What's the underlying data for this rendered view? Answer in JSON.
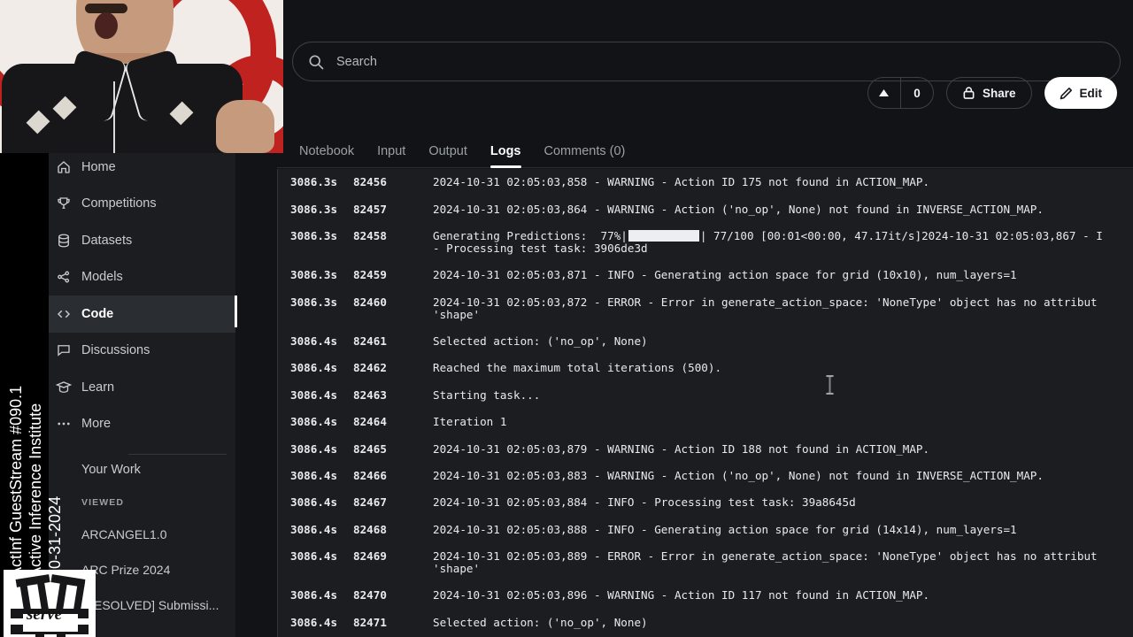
{
  "overlay": {
    "vertical_title_line1": "ActInf GuestStream #090.1",
    "vertical_title_line2": "Active Inference Institute",
    "vertical_title_line3": "10-31-2024",
    "logo_text": "serve"
  },
  "search": {
    "placeholder": "Search",
    "value": "",
    "icon": "search-icon"
  },
  "top_actions": {
    "upvote_icon": "caret-up-icon",
    "vote_count": "0",
    "share_label": "Share",
    "share_icon": "lock-icon",
    "edit_label": "Edit",
    "edit_icon": "pencil-icon"
  },
  "tabs": [
    {
      "label": "Notebook",
      "active": false
    },
    {
      "label": "Input",
      "active": false
    },
    {
      "label": "Output",
      "active": false
    },
    {
      "label": "Logs",
      "active": true
    },
    {
      "label": "Comments (0)",
      "active": false
    }
  ],
  "sidebar": {
    "items": [
      {
        "label": "Home",
        "icon": "home-icon",
        "active": false
      },
      {
        "label": "Competitions",
        "icon": "trophy-icon",
        "active": false
      },
      {
        "label": "Datasets",
        "icon": "datasets-icon",
        "active": false
      },
      {
        "label": "Models",
        "icon": "models-icon",
        "active": false
      },
      {
        "label": "Code",
        "icon": "code-icon",
        "active": true
      },
      {
        "label": "Discussions",
        "icon": "discussions-icon",
        "active": false
      },
      {
        "label": "Learn",
        "icon": "learn-icon",
        "active": false
      },
      {
        "label": "More",
        "icon": "more-icon",
        "active": false
      }
    ],
    "your_work_label": "Your Work",
    "viewed_label": "VIEWED",
    "viewed_items": [
      {
        "label": "ARCANGEL1.0"
      },
      {
        "label": "ARC Prize 2024"
      },
      {
        "label": "[RESOLVED] Submissi..."
      }
    ]
  },
  "logs": {
    "rows": [
      {
        "time": "3086.3s",
        "num": "82456",
        "msg": "2024-10-31 02:05:03,858 - WARNING - Action ID 175 not found in ACTION_MAP."
      },
      {
        "time": "3086.3s",
        "num": "82457",
        "msg": "2024-10-31 02:05:03,864 - WARNING - Action ('no_op', None) not found in INVERSE_ACTION_MAP."
      },
      {
        "time": "3086.3s",
        "num": "82458",
        "msg_pre": "Generating Predictions:  77%|",
        "progress_bar": true,
        "msg_post": "| 77/100 [00:01<00:00, 47.17it/s]2024-10-31 02:05:03,867 - I",
        "msg_cont": "- Processing test task: 3906de3d"
      },
      {
        "time": "3086.3s",
        "num": "82459",
        "msg": "2024-10-31 02:05:03,871 - INFO - Generating action space for grid (10x10), num_layers=1"
      },
      {
        "time": "3086.3s",
        "num": "82460",
        "msg": "2024-10-31 02:05:03,872 - ERROR - Error in generate_action_space: 'NoneType' object has no attribut",
        "msg_cont": "'shape'"
      },
      {
        "time": "3086.4s",
        "num": "82461",
        "msg": "Selected action: ('no_op', None)"
      },
      {
        "time": "3086.4s",
        "num": "82462",
        "msg": "Reached the maximum total iterations (500)."
      },
      {
        "time": "3086.4s",
        "num": "82463",
        "msg": "Starting task..."
      },
      {
        "time": "3086.4s",
        "num": "82464",
        "msg": "Iteration 1"
      },
      {
        "time": "3086.4s",
        "num": "82465",
        "msg": "2024-10-31 02:05:03,879 - WARNING - Action ID 188 not found in ACTION_MAP."
      },
      {
        "time": "3086.4s",
        "num": "82466",
        "msg": "2024-10-31 02:05:03,883 - WARNING - Action ('no_op', None) not found in INVERSE_ACTION_MAP."
      },
      {
        "time": "3086.4s",
        "num": "82467",
        "msg": "2024-10-31 02:05:03,884 - INFO - Processing test task: 39a8645d"
      },
      {
        "time": "3086.4s",
        "num": "82468",
        "msg": "2024-10-31 02:05:03,888 - INFO - Generating action space for grid (14x14), num_layers=1"
      },
      {
        "time": "3086.4s",
        "num": "82469",
        "msg": "2024-10-31 02:05:03,889 - ERROR - Error in generate_action_space: 'NoneType' object has no attribut",
        "msg_cont": "'shape'"
      },
      {
        "time": "3086.4s",
        "num": "82470",
        "msg": "2024-10-31 02:05:03,896 - WARNING - Action ID 117 not found in ACTION_MAP."
      },
      {
        "time": "3086.4s",
        "num": "82471",
        "msg": "Selected action: ('no_op', None)"
      }
    ]
  },
  "colors": {
    "app_bg": "#121317",
    "log_bg": "#1b1d21",
    "drawer_bg": "#1b1d21",
    "active_nav": "#2a2d32",
    "accent_white": "#ffffff",
    "muted_text": "#9aa0a6",
    "cam_red": "#c0221f"
  }
}
